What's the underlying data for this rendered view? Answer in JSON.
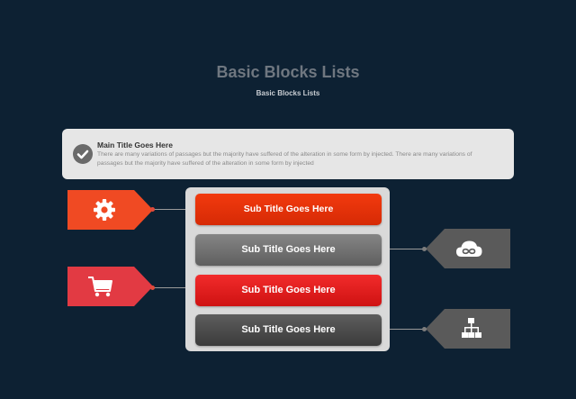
{
  "header": {
    "title": "Basic Blocks Lists",
    "subtitle": "Basic Blocks Lists"
  },
  "info": {
    "title": "Main Title Goes Here",
    "text": "There are many variations of passages but the majority have  suffered of the alteration in some form by injected. There are many variations of passages but the majority have  suffered of the alteration in some form by injected",
    "icon": "check-circle-icon"
  },
  "items": [
    {
      "label": "Sub Title Goes Here",
      "color": "#e8330a",
      "icon": "gear-icon",
      "side": "left"
    },
    {
      "label": "Sub Title Goes Here",
      "color": "#6f6f6f",
      "icon": "cloud-infinity-icon",
      "side": "right"
    },
    {
      "label": "Sub Title Goes Here",
      "color": "#e32222",
      "icon": "cart-icon",
      "side": "left"
    },
    {
      "label": "Sub Title Goes Here",
      "color": "#4a4a4a",
      "icon": "sitemap-icon",
      "side": "right"
    }
  ],
  "colors": {
    "background": "#0d2133",
    "tag_orange": "#f04a23",
    "tag_red": "#e23a43",
    "tag_gray": "#5a5a5a"
  }
}
